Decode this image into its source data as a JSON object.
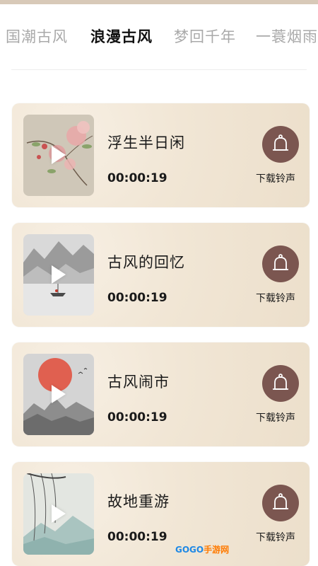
{
  "tabs": [
    {
      "label": "国潮古风",
      "active": false
    },
    {
      "label": "浪漫古风",
      "active": true
    },
    {
      "label": "梦回千年",
      "active": false
    },
    {
      "label": "一蓑烟雨",
      "active": false
    }
  ],
  "ringtones": [
    {
      "title": "浮生半日闲",
      "duration": "00:00:19",
      "download_label": "下载铃声",
      "thumb_icon": "flower-painting"
    },
    {
      "title": "古风的回忆",
      "duration": "00:00:19",
      "download_label": "下载铃声",
      "thumb_icon": "landscape-boat-painting"
    },
    {
      "title": "古风闹市",
      "duration": "00:00:19",
      "download_label": "下载铃声",
      "thumb_icon": "red-sun-mountain-painting"
    },
    {
      "title": "故地重游",
      "duration": "00:00:19",
      "download_label": "下载铃声",
      "thumb_icon": "willow-painting"
    }
  ],
  "watermark": {
    "part1": "GOGO",
    "part2": "手游网"
  },
  "colors": {
    "card_bg": "#f1e6d5",
    "download_button": "#7b5650",
    "active_tab": "#111111",
    "inactive_tab": "#a9a9a9"
  }
}
